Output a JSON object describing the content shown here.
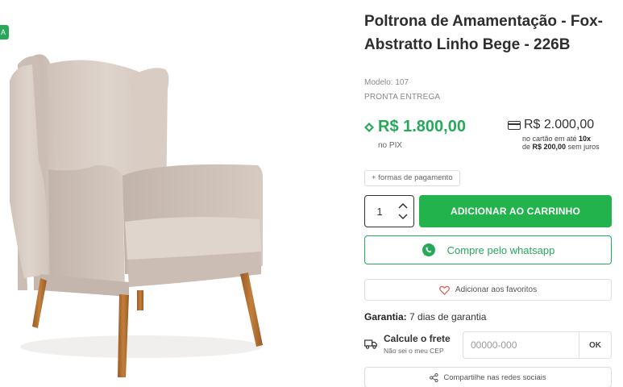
{
  "badge": {
    "text": "A"
  },
  "product": {
    "title": "Poltrona de Amamentação - Fox- Abstratto Linho Bege - 226B",
    "model": "Modelo: 107",
    "availability": "PRONTA ENTREGA"
  },
  "pricing": {
    "pix_price": "R$ 1.800,00",
    "pix_label": "no PIX",
    "card_price": "R$ 2.000,00",
    "card_note_prefix": "no cartão em até ",
    "card_note_installments": "10x",
    "card_note_de": "de ",
    "card_note_amount": "R$ 200,00",
    "card_note_suffix": " sem juros",
    "payment_options_label": "+ formas de pagamento"
  },
  "purchase": {
    "quantity": "1",
    "add_to_cart_label": "ADICIONAR AO CARRINHO",
    "whatsapp_label": "Compre pelo whatsapp",
    "favorites_label": "Adicionar aos favoritos"
  },
  "warranty": {
    "label": "Garantia:",
    "value": " 7 dias de garantia"
  },
  "shipping": {
    "title": "Calcule o frete",
    "cep_link": "Não sei o meu CEP",
    "cep_placeholder": "00000-000",
    "ok_label": "OK"
  },
  "share": {
    "label": "Compartilhe nas redes sociais"
  },
  "colors": {
    "accent_green": "#27a85a",
    "cart_green": "#22b34c",
    "chair_fabric": "#d9cdc5",
    "chair_legs": "#b06e2e"
  },
  "icons": {
    "pix": "pix-icon",
    "card": "credit-card-icon",
    "whatsapp": "whatsapp-icon",
    "favorite": "heart-icon",
    "shipping": "truck-icon",
    "share": "share-icon",
    "qty_up": "chevron-up-icon",
    "qty_down": "chevron-down-icon"
  }
}
